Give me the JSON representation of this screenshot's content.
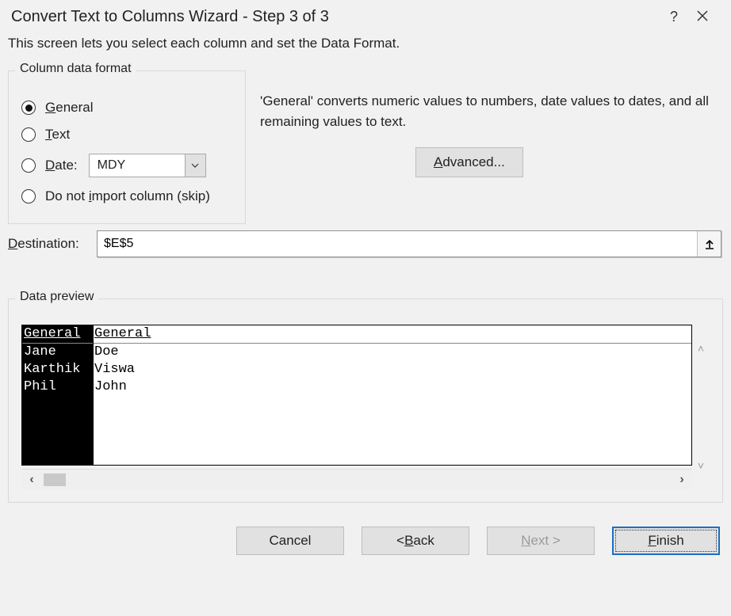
{
  "titlebar": {
    "title": "Convert Text to Columns Wizard - Step 3 of 3"
  },
  "subtitle": "This screen lets you select each column and set the Data Format.",
  "format": {
    "legend": "Column data format",
    "options": {
      "general_u": "G",
      "general_rest": "eneral",
      "text_u": "T",
      "text_rest": "ext",
      "date_u": "D",
      "date_rest": "ate:",
      "date_value": "MDY",
      "skip_pre": "Do not ",
      "skip_u": "i",
      "skip_post": "mport column (skip)"
    }
  },
  "desc": "'General' converts numeric values to numbers, date values to dates, and all remaining values to text.",
  "advanced_u": "A",
  "advanced_rest": "dvanced...",
  "dest": {
    "label_u": "D",
    "label_rest": "estination:",
    "value": "$E$5"
  },
  "preview": {
    "legend": "Data preview",
    "col1_header": "General",
    "col2_header": "General",
    "rows": [
      {
        "c1": "Jane",
        "c2": "Doe"
      },
      {
        "c1": "Karthik",
        "c2": "Viswa"
      },
      {
        "c1": "Phil",
        "c2": "John"
      }
    ]
  },
  "buttons": {
    "cancel": "Cancel",
    "back_pre": "< ",
    "back_u": "B",
    "back_post": "ack",
    "next_u": "N",
    "next_post": "ext >",
    "finish_u": "F",
    "finish_post": "inish"
  }
}
